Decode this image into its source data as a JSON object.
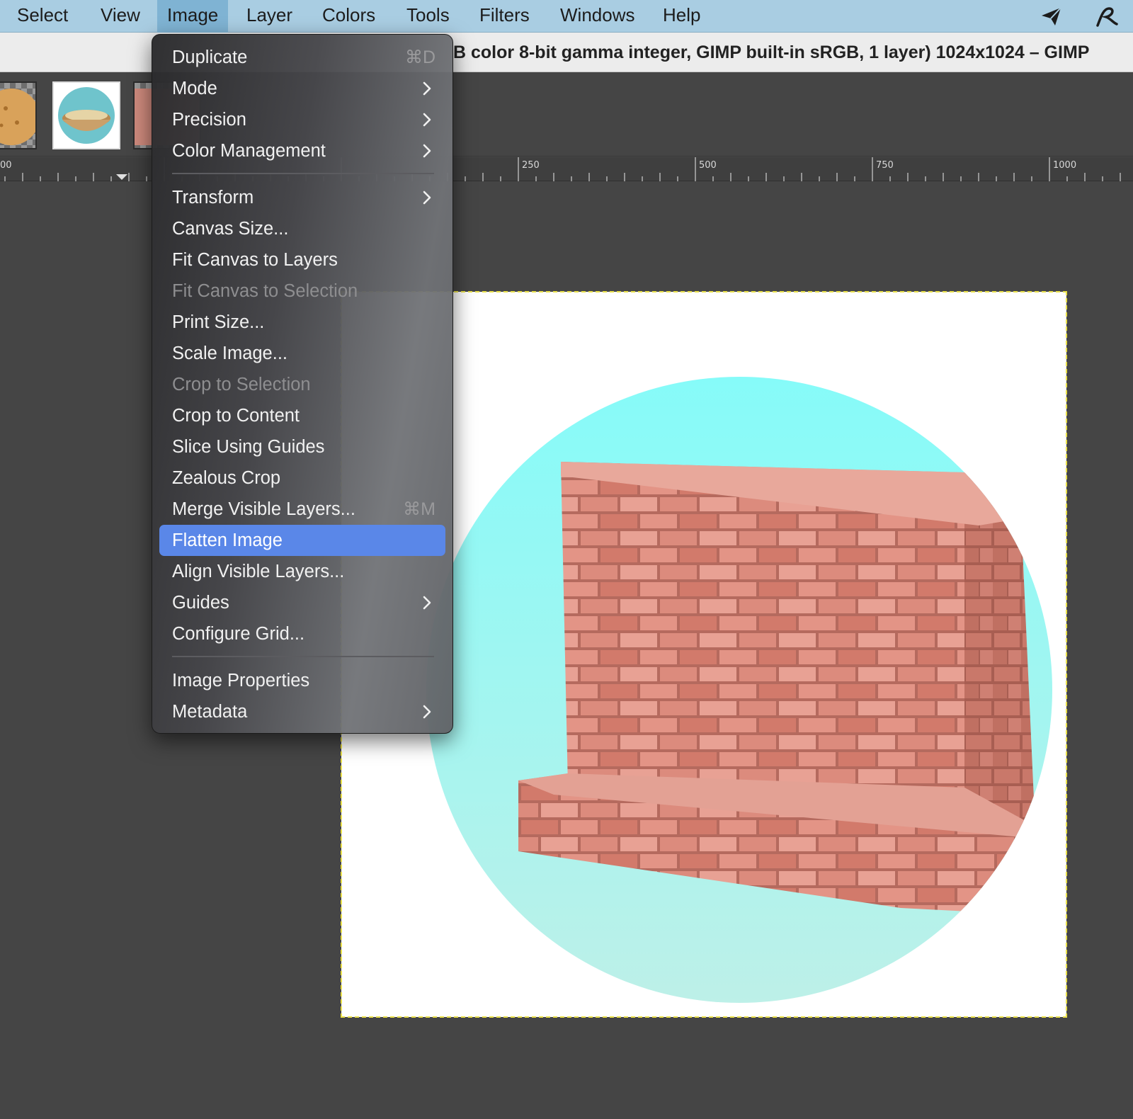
{
  "menubar": {
    "items": [
      {
        "label": "Select"
      },
      {
        "label": "View"
      },
      {
        "label": "Image"
      },
      {
        "label": "Layer"
      },
      {
        "label": "Colors"
      },
      {
        "label": "Tools"
      },
      {
        "label": "Filters"
      },
      {
        "label": "Windows"
      },
      {
        "label": "Help"
      }
    ],
    "active": "Image",
    "right_icons": [
      "paper-plane-icon",
      "signature-icon"
    ]
  },
  "window": {
    "title": "B color 8-bit gamma integer, GIMP built-in sRGB, 1 layer) 1024x1024 – GIMP"
  },
  "ruler": {
    "labels": [
      "00",
      "250",
      "500",
      "750",
      "1000"
    ]
  },
  "image_menu": {
    "items": [
      {
        "label": "Duplicate",
        "shortcut": "⌘D",
        "enabled": true,
        "submenu": false
      },
      {
        "label": "Mode",
        "shortcut": "",
        "enabled": true,
        "submenu": true
      },
      {
        "label": "Precision",
        "shortcut": "",
        "enabled": true,
        "submenu": true
      },
      {
        "label": "Color Management",
        "shortcut": "",
        "enabled": true,
        "submenu": true
      },
      {
        "label": "Transform",
        "shortcut": "",
        "enabled": true,
        "submenu": true
      },
      {
        "label": "Canvas Size...",
        "shortcut": "",
        "enabled": true,
        "submenu": false
      },
      {
        "label": "Fit Canvas to Layers",
        "shortcut": "",
        "enabled": true,
        "submenu": false
      },
      {
        "label": "Fit Canvas to Selection",
        "shortcut": "",
        "enabled": false,
        "submenu": false
      },
      {
        "label": "Print Size...",
        "shortcut": "",
        "enabled": true,
        "submenu": false
      },
      {
        "label": "Scale Image...",
        "shortcut": "",
        "enabled": true,
        "submenu": false
      },
      {
        "label": "Crop to Selection",
        "shortcut": "",
        "enabled": false,
        "submenu": false
      },
      {
        "label": "Crop to Content",
        "shortcut": "",
        "enabled": true,
        "submenu": false
      },
      {
        "label": "Slice Using Guides",
        "shortcut": "",
        "enabled": true,
        "submenu": false
      },
      {
        "label": "Zealous Crop",
        "shortcut": "",
        "enabled": true,
        "submenu": false
      },
      {
        "label": "Merge Visible Layers...",
        "shortcut": "⌘M",
        "enabled": true,
        "submenu": false
      },
      {
        "label": "Flatten Image",
        "shortcut": "",
        "enabled": true,
        "submenu": false,
        "highlighted": true
      },
      {
        "label": "Align Visible Layers...",
        "shortcut": "",
        "enabled": true,
        "submenu": false
      },
      {
        "label": "Guides",
        "shortcut": "",
        "enabled": true,
        "submenu": true
      },
      {
        "label": "Configure Grid...",
        "shortcut": "",
        "enabled": true,
        "submenu": false
      },
      {
        "label": "Image Properties",
        "shortcut": "",
        "enabled": true,
        "submenu": false
      },
      {
        "label": "Metadata",
        "shortcut": "",
        "enabled": true,
        "submenu": true
      }
    ]
  },
  "colors": {
    "menubar_bg": "#a9cde2",
    "menu_highlight": "#5a87e8",
    "workspace_bg": "#454545",
    "circle": "#89f8f6",
    "brick": "#d98a7c",
    "selection_border": "#e9e04a"
  }
}
